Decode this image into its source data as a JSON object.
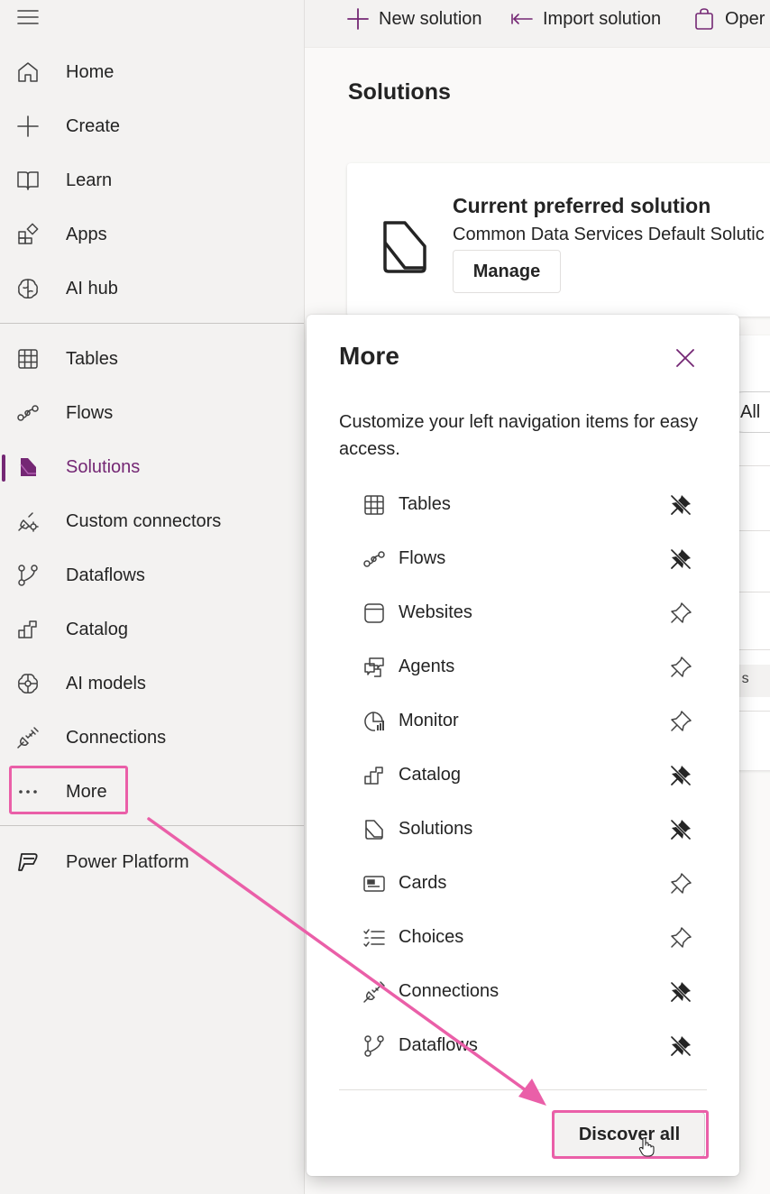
{
  "colors": {
    "accent": "#742774",
    "highlight": "#ea5fa8",
    "sidebar_bg": "#f3f2f1",
    "panel_bg": "#ffffff"
  },
  "sidebar": {
    "menu_icon": "hamburger-icon",
    "items": [
      {
        "label": "Home",
        "icon": "home-icon"
      },
      {
        "label": "Create",
        "icon": "plus-icon"
      },
      {
        "label": "Learn",
        "icon": "book-icon"
      },
      {
        "label": "Apps",
        "icon": "apps-icon"
      },
      {
        "label": "AI hub",
        "icon": "brain-icon"
      },
      {
        "label": "Tables",
        "icon": "table-icon"
      },
      {
        "label": "Flows",
        "icon": "flow-icon"
      },
      {
        "label": "Solutions",
        "icon": "solutions-icon",
        "active": true
      },
      {
        "label": "Custom connectors",
        "icon": "custom-connector-icon"
      },
      {
        "label": "Dataflows",
        "icon": "dataflow-icon"
      },
      {
        "label": "Catalog",
        "icon": "catalog-icon"
      },
      {
        "label": "AI models",
        "icon": "ai-model-icon"
      },
      {
        "label": "Connections",
        "icon": "connection-icon"
      },
      {
        "label": "More",
        "icon": "more-icon"
      },
      {
        "label": "Power Platform",
        "icon": "power-platform-icon"
      }
    ]
  },
  "command_bar": {
    "new_solution": "New solution",
    "import_solution": "Import solution",
    "open": "Oper"
  },
  "main": {
    "title": "Solutions",
    "preferred": {
      "title": "Current preferred solution",
      "subtitle": "Common Data Services Default Solutic",
      "manage_label": "Manage"
    },
    "filter_all": "All",
    "row_chip_text": "red s"
  },
  "more_panel": {
    "title": "More",
    "description": "Customize your left navigation items for easy access.",
    "items": [
      {
        "label": "Tables",
        "icon": "table-icon",
        "pinned": true
      },
      {
        "label": "Flows",
        "icon": "flow-icon",
        "pinned": true
      },
      {
        "label": "Websites",
        "icon": "website-icon",
        "pinned": false
      },
      {
        "label": "Agents",
        "icon": "agents-icon",
        "pinned": false
      },
      {
        "label": "Monitor",
        "icon": "monitor-icon",
        "pinned": false
      },
      {
        "label": "Catalog",
        "icon": "catalog-icon",
        "pinned": true
      },
      {
        "label": "Solutions",
        "icon": "solutions-icon",
        "pinned": true
      },
      {
        "label": "Cards",
        "icon": "cards-icon",
        "pinned": false
      },
      {
        "label": "Choices",
        "icon": "choices-icon",
        "pinned": false
      },
      {
        "label": "Connections",
        "icon": "connection-icon",
        "pinned": true
      },
      {
        "label": "Dataflows",
        "icon": "dataflow-icon",
        "pinned": true
      }
    ],
    "discover_label": "Discover all"
  }
}
